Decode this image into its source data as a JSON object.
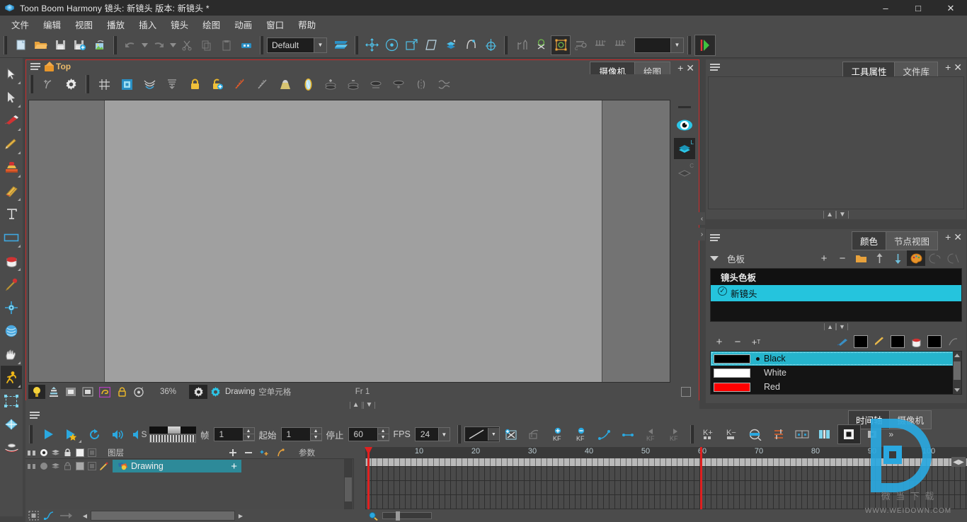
{
  "window": {
    "title": "Toon Boom Harmony 镜头: 新镜头 版本: 新镜头 *",
    "minimize": "–",
    "maximize": "□",
    "close": "✕"
  },
  "menu": {
    "items": [
      "文件",
      "编辑",
      "视图",
      "播放",
      "插入",
      "镜头",
      "绘图",
      "动画",
      "窗口",
      "帮助"
    ]
  },
  "main_toolbar": {
    "resolution_combo": "Default",
    "empty_combo": "",
    "buttons": [
      "new-scene",
      "open-scene",
      "save",
      "save-all",
      "export-render"
    ]
  },
  "left_tools": {
    "names": [
      "select-tool",
      "cutter-select-tool",
      "brush-tool",
      "pencil-tool",
      "stamp-tool",
      "eraser-tool",
      "text-tool",
      "rectangle-tool",
      "paint-bucket-tool",
      "dropper-tool",
      "transform-pivot-tool",
      "smooth-editor-tool",
      "hand-tool",
      "animate-tool",
      "select-frame-tool",
      "morph-tool",
      "zoom-tool"
    ],
    "selected": "animate-tool"
  },
  "camera_panel": {
    "view_title": "Top",
    "tabs": [
      {
        "label": "摄像机",
        "active": true
      },
      {
        "label": "绘图",
        "active": false
      }
    ],
    "add_icon": "+",
    "close_icon": "✕",
    "status": {
      "zoom": "36%",
      "frame": "Fr 1",
      "layer_name": "Drawing",
      "layer_state": "空单元格"
    }
  },
  "right_top_panel": {
    "tabs": [
      {
        "label": "工具属性",
        "active": true
      },
      {
        "label": "文件库",
        "active": false
      }
    ],
    "add_icon": "+",
    "close_icon": "✕"
  },
  "color_panel": {
    "tabs": [
      {
        "label": "颜色",
        "active": true
      },
      {
        "label": "节点视图",
        "active": false
      }
    ],
    "add_icon": "+",
    "close_icon": "✕",
    "palette_section_label": "色板",
    "palette_buttons": [
      "add-palette",
      "remove-palette",
      "folder",
      "move-up",
      "move-down",
      "palette-mode",
      "link-palette",
      "unlink-palette"
    ],
    "palette_list": {
      "header": "镜头色板",
      "items": [
        {
          "label": "新镜头",
          "checked": true,
          "selected": true
        }
      ]
    },
    "swatch_toolbar": [
      "add-color",
      "remove-color",
      "add-text-color",
      "brush-swatch",
      "pencil-swatch",
      "paint-swatch",
      "reset"
    ],
    "colors": [
      {
        "name": "Black",
        "hex": "#000000",
        "selected": true,
        "current": true
      },
      {
        "name": "White",
        "hex": "#ffffff",
        "selected": false,
        "current": false
      },
      {
        "name": "Red",
        "hex": "#ff0000",
        "selected": false,
        "current": false
      }
    ]
  },
  "timeline_panel": {
    "tabs": [
      {
        "label": "时间轴",
        "active": true
      },
      {
        "label": "摄像机",
        "active": false
      }
    ],
    "playback": {
      "play": "play-button",
      "loop": "loop-button",
      "sound": "sound-button",
      "sound_scrub": "S",
      "frame_label": "帧",
      "frame_value": "1",
      "start_label": "起始",
      "start_value": "1",
      "stop_label": "停止",
      "stop_value": "60",
      "fps_label": "FPS",
      "fps_value": "24"
    },
    "layers": {
      "name_column": "图层",
      "param_column": "参数",
      "rows": [
        {
          "name": "Drawing",
          "selected": true
        }
      ],
      "add_icon": "+",
      "remove_icon": "–"
    },
    "ruler": {
      "ticks": [
        10,
        20,
        30,
        40,
        50,
        60,
        70,
        80,
        90,
        100
      ],
      "playhead_frame": 1,
      "scene_end_frame": 60
    }
  },
  "watermark": {
    "site": "WWW.WEIDOWN.COM",
    "cn": "微 当 下 载"
  },
  "colors": {
    "accent_cyan": "#25c4dd",
    "panel_bg": "#4b4b4b",
    "dark_bg": "#141414",
    "red_border": "#cf2b2b",
    "orange": "#e8962a"
  }
}
